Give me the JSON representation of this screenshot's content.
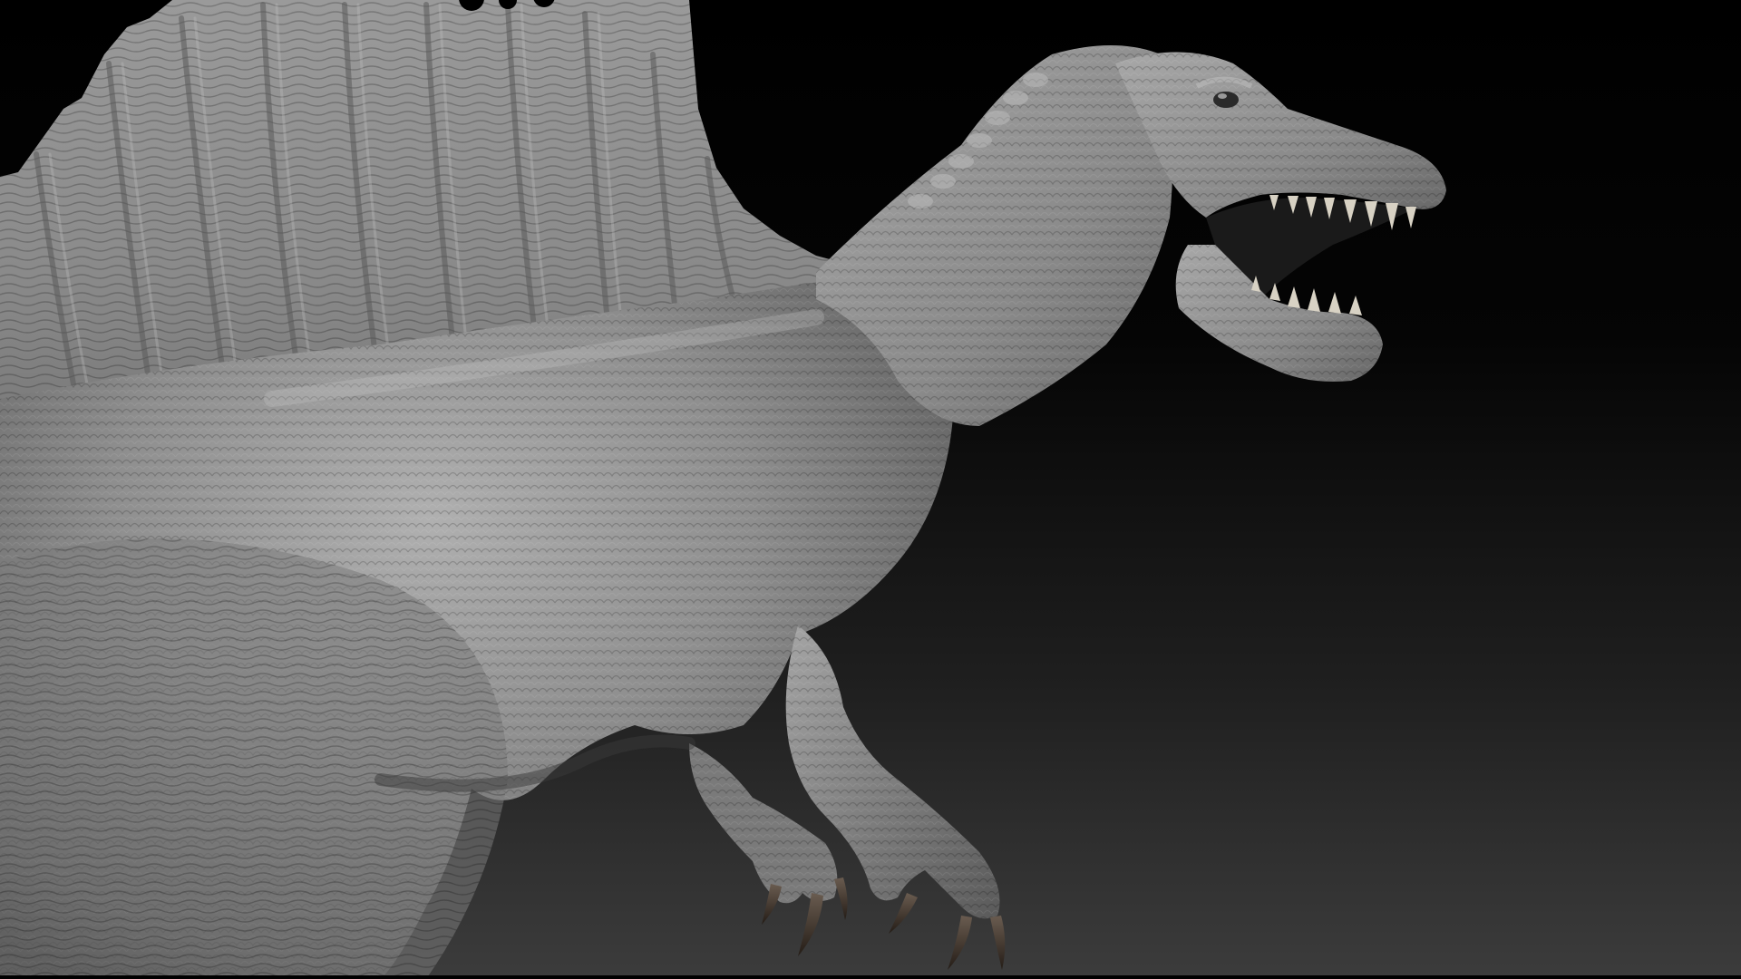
{
  "scene": {
    "subject": "spinosaurus-sculpt",
    "colors": {
      "background_top": "#000000",
      "background_mid": "#0c0c0c",
      "background_bottom": "#3a3a3a",
      "skin_light": "#b4b4b4",
      "skin_mid": "#8c8c8c",
      "skin_dark": "#4a4a4a",
      "claw": "#3a302a",
      "teeth": "#d8d2c4"
    }
  }
}
